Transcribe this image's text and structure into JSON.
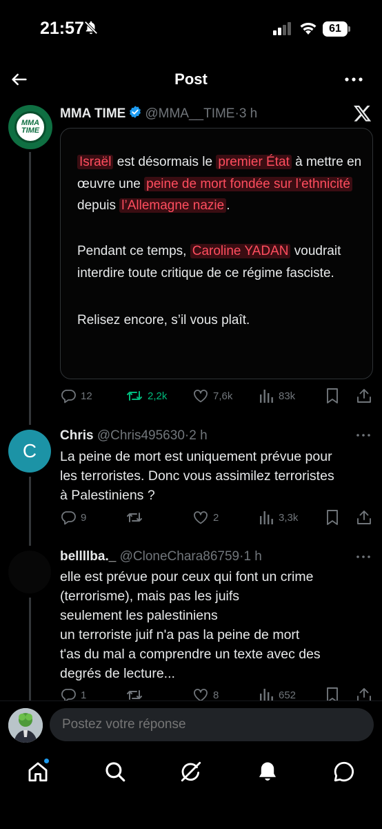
{
  "status_bar": {
    "time": "21:57",
    "battery": "61"
  },
  "nav": {
    "title": "Post"
  },
  "main_post": {
    "author_name": "MMA TIME",
    "handle": "@MMA__TIME",
    "time": "3 h",
    "avatar_text": [
      "MMA",
      "TIME"
    ],
    "embed": {
      "para1": [
        {
          "t": "Israël",
          "hl": true
        },
        {
          "t": " est désormais le ",
          "hl": false
        },
        {
          "t": "premier État",
          "hl": true
        },
        {
          "t": " à mettre en œuvre une ",
          "hl": false
        },
        {
          "t": "peine de mort fondée sur l’ethnicité",
          "hl": true
        },
        {
          "t": " depuis ",
          "hl": false
        },
        {
          "t": "l’Allemagne nazie",
          "hl": true
        },
        {
          "t": ".",
          "hl": false
        }
      ],
      "para2": [
        {
          "t": "Pendant ce temps, ",
          "hl": false
        },
        {
          "t": "Caroline YADAN",
          "hl": true
        },
        {
          "t": " voudrait interdire toute critique de ce régime fasciste.",
          "hl": false
        }
      ],
      "para3": "Relisez encore, s’il vous plaît."
    },
    "stats": {
      "replies": "12",
      "reposts": "2,2k",
      "likes": "7,6k",
      "views": "83k"
    }
  },
  "replies": [
    {
      "author_name": "Chris",
      "handle": "@Chris495630",
      "time": "2 h",
      "avatar_letter": "C",
      "lines": [
        "La peine de mort est uniquement prévue pour",
        "les terroristes. Donc vous assimilez terroristes",
        "à Palestiniens ?"
      ],
      "stats": {
        "replies": "9",
        "reposts": "",
        "likes": "2",
        "views": "3,3k"
      }
    },
    {
      "author_name": "bellllba._",
      "handle": "@CloneChara86759",
      "time": "1 h",
      "lines": [
        "elle est prévue pour ceux qui font un crime",
        "(terrorisme), mais pas les juifs",
        "seulement les palestiniens",
        "un terroriste juif n'a pas la peine de mort",
        "t'as du mal a comprendre un texte avec des",
        "degrés de lecture..."
      ],
      "stats": {
        "replies": "1",
        "reposts": "",
        "likes": "8",
        "views": "652"
      }
    }
  ],
  "composer": {
    "placeholder": "Postez votre réponse"
  },
  "colors": {
    "accent": "#1d9bf0",
    "repost_active": "#00ba7c",
    "highlight_text": "#ff4d5e",
    "highlight_bg": "#3a0d12",
    "muted": "#71767b"
  },
  "tab_bar": {
    "icons": [
      "home-icon",
      "search-icon",
      "grok-icon",
      "notifications-icon",
      "messages-icon"
    ]
  }
}
